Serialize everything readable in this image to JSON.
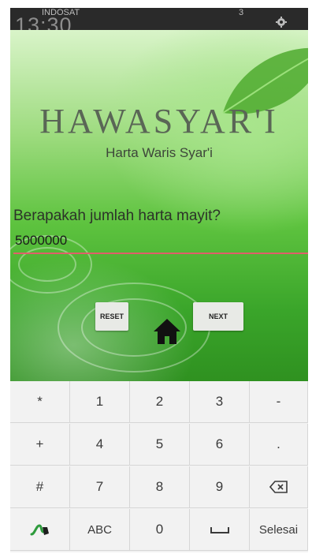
{
  "status_bar": {
    "clock": "13:30",
    "carrier": "INDOSAT",
    "signal_text": "3"
  },
  "app": {
    "title": "HAWASYAR'I",
    "subtitle": "Harta Waris Syar'i",
    "question": "Berapakah jumlah harta mayit?",
    "amount_value": "5000000",
    "reset_label": "RESET",
    "next_label": "NEXT"
  },
  "keyboard": {
    "row1": [
      "*",
      "1",
      "2",
      "3",
      "-"
    ],
    "row2": [
      "+",
      "4",
      "5",
      "6",
      "."
    ],
    "row3": [
      "#",
      "7",
      "8",
      "9"
    ],
    "abc_label": "ABC",
    "zero_label": "0",
    "done_label": "Selesai"
  },
  "colors": {
    "accent_underline": "#e0606a",
    "keyboard_bg": "#f2f2f2",
    "swype_green": "#2e9b3c"
  }
}
